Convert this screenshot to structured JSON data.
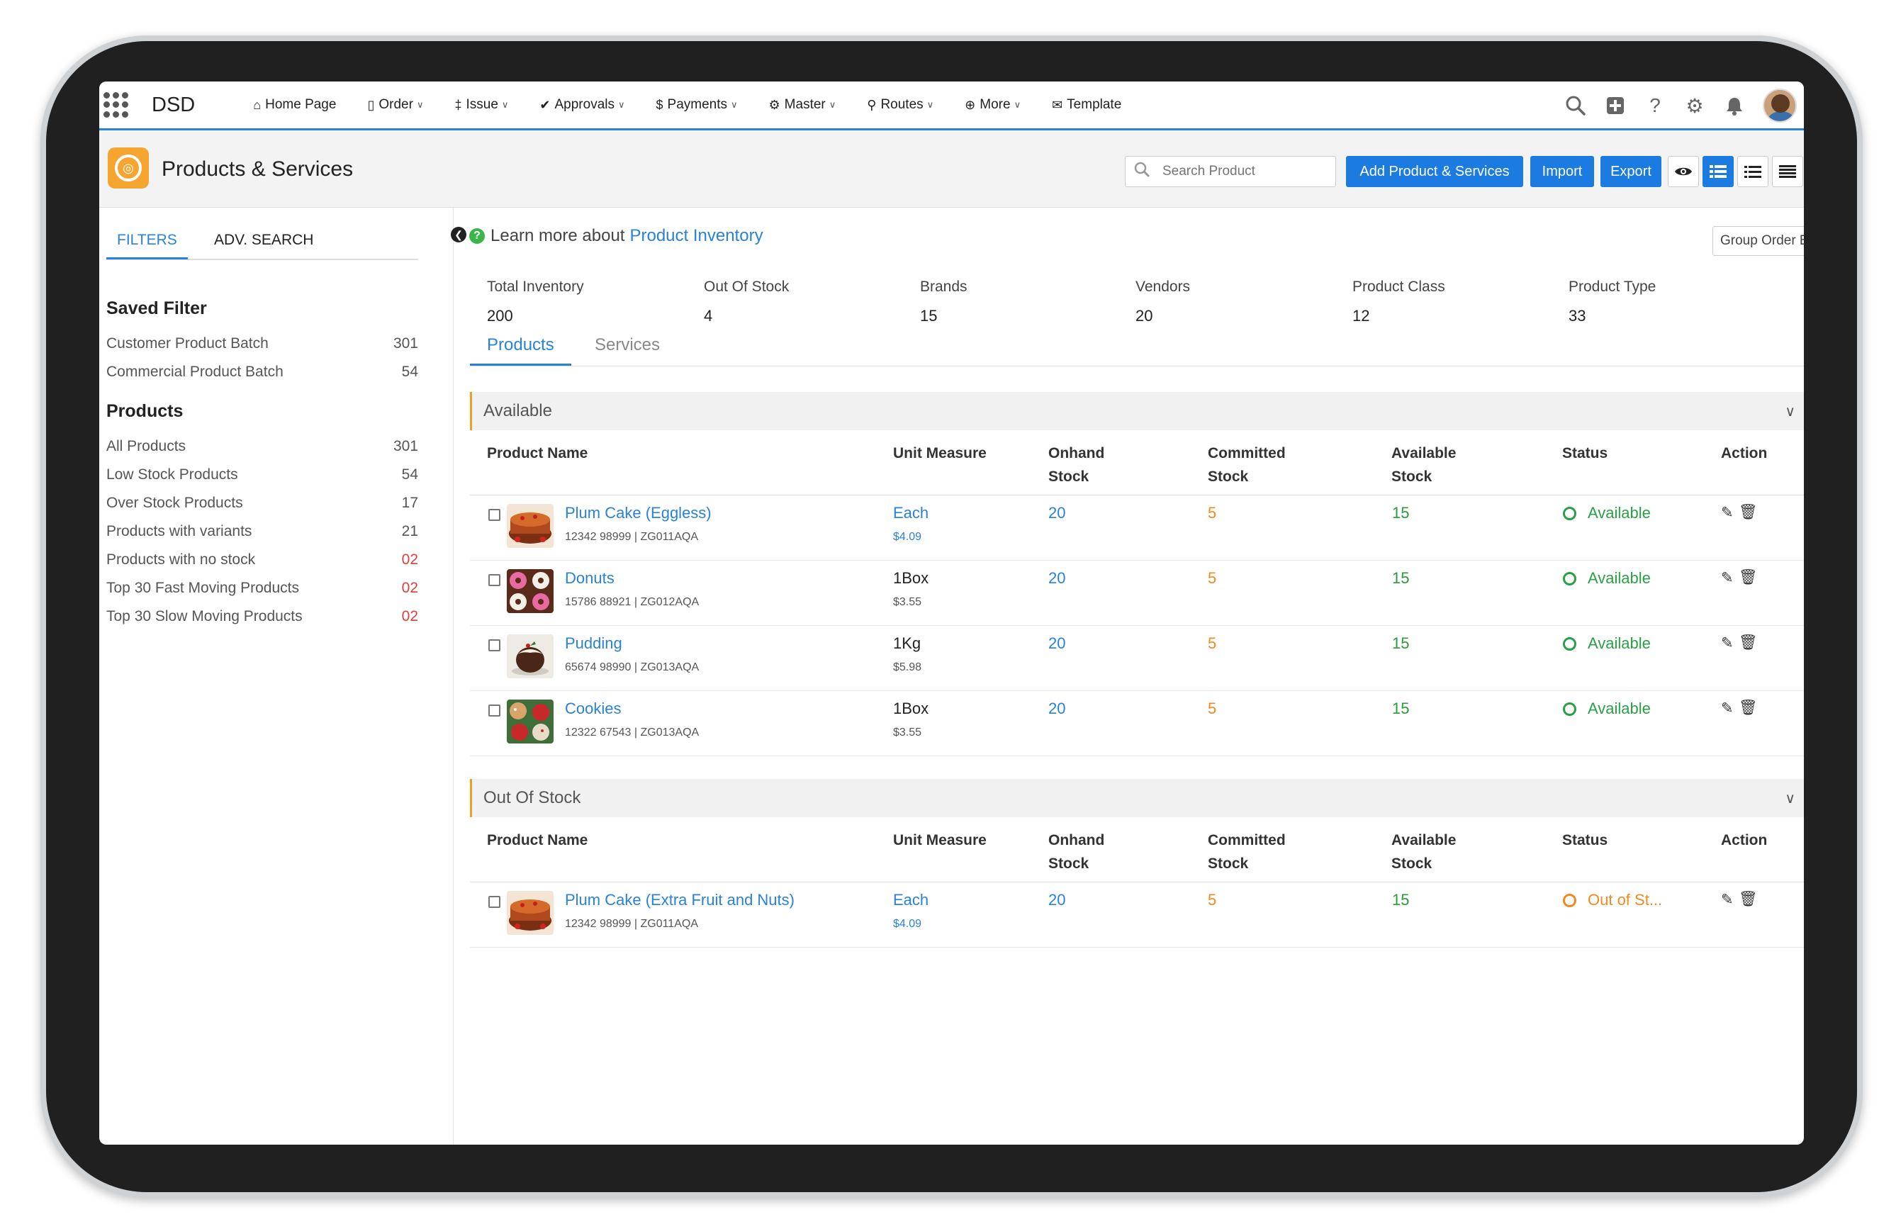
{
  "app": {
    "name": "DSD"
  },
  "nav": [
    {
      "icon": "home-icon",
      "glyph": "⌂",
      "label": "Home Page",
      "dropdown": false
    },
    {
      "icon": "document-icon",
      "glyph": "□",
      "label": "Order",
      "dropdown": true
    },
    {
      "icon": "issue-icon",
      "glyph": "‡",
      "label": "Issue",
      "dropdown": true
    },
    {
      "icon": "check-icon",
      "glyph": "✔",
      "label": "Approvals",
      "dropdown": true
    },
    {
      "icon": "dollar-icon",
      "glyph": "$",
      "label": "Payments",
      "dropdown": true
    },
    {
      "icon": "gear-icon",
      "glyph": "⚙",
      "label": "Master",
      "dropdown": true
    },
    {
      "icon": "map-pin-icon",
      "glyph": "▾",
      "label": "Routes",
      "dropdown": true
    },
    {
      "icon": "plus-circle-icon",
      "glyph": "⊕",
      "label": "More",
      "dropdown": true
    },
    {
      "icon": "envelope-icon",
      "glyph": "✉",
      "label": "Template",
      "dropdown": false
    }
  ],
  "page": {
    "title": "Products & Services"
  },
  "search": {
    "placeholder": "Search Product"
  },
  "buttons": {
    "add": "Add Product & Services",
    "import": "Import",
    "export": "Export"
  },
  "sidebar": {
    "tabs": [
      "FILTERS",
      "ADV. SEARCH"
    ],
    "saved_filter_heading": "Saved Filter",
    "saved_filters": [
      {
        "label": "Customer Product Batch",
        "count": "301",
        "red": false
      },
      {
        "label": "Commercial Product Batch",
        "count": "54",
        "red": false
      }
    ],
    "products_heading": "Products",
    "product_filters": [
      {
        "label": "All Products",
        "count": "301",
        "red": false
      },
      {
        "label": "Low Stock Products",
        "count": "54",
        "red": false
      },
      {
        "label": "Over Stock Products",
        "count": "17",
        "red": false
      },
      {
        "label": "Products with variants",
        "count": "21",
        "red": false
      },
      {
        "label": "Products with no stock",
        "count": "02",
        "red": true
      },
      {
        "label": "Top 30 Fast Moving Products",
        "count": "02",
        "red": true
      },
      {
        "label": "Top 30 Slow Moving Products",
        "count": "02",
        "red": true
      }
    ]
  },
  "learn": {
    "prefix": "Learn more about",
    "link": "Product Inventory"
  },
  "group_by": {
    "selected": "Group Order By"
  },
  "stats": [
    {
      "label": "Total Inventory",
      "value": "200"
    },
    {
      "label": "Out Of Stock",
      "value": "4"
    },
    {
      "label": "Brands",
      "value": "15"
    },
    {
      "label": "Vendors",
      "value": "20"
    },
    {
      "label": "Product Class",
      "value": "12"
    },
    {
      "label": "Product Type",
      "value": "33"
    }
  ],
  "product_tabs": [
    "Products",
    "Services"
  ],
  "columns": {
    "name": "Product Name",
    "uom": "Unit Measure",
    "onhand1": "Onhand",
    "onhand2": "Stock",
    "committed1": "Committed",
    "committed2": "Stock",
    "available1": "Available",
    "available2": "Stock",
    "status": "Status",
    "action": "Action"
  },
  "groups": {
    "available": {
      "title": "Available",
      "rows": [
        {
          "name": "Plum Cake (Eggless)",
          "sku": "12342 98999 | ZG011AQA",
          "uom": "Each",
          "price": "$4.09",
          "uom_blue": true,
          "onhand": "20",
          "committed": "5",
          "available": "15",
          "status": "Available"
        },
        {
          "name": "Donuts",
          "sku": "15786 88921 | ZG012AQA",
          "uom": "1Box",
          "price": "$3.55",
          "uom_blue": false,
          "onhand": "20",
          "committed": "5",
          "available": "15",
          "status": "Available"
        },
        {
          "name": "Pudding",
          "sku": "65674 98990 | ZG013AQA",
          "uom": "1Kg",
          "price": "$5.98",
          "uom_blue": false,
          "onhand": "20",
          "committed": "5",
          "available": "15",
          "status": "Available"
        },
        {
          "name": "Cookies",
          "sku": "12322 67543 | ZG013AQA",
          "uom": "1Box",
          "price": "$3.55",
          "uom_blue": false,
          "onhand": "20",
          "committed": "5",
          "available": "15",
          "status": "Available"
        }
      ]
    },
    "out_of_stock": {
      "title": "Out Of Stock",
      "rows": [
        {
          "name": "Plum Cake (Extra Fruit and Nuts)",
          "sku": "12342 98999 | ZG011AQA",
          "uom": "Each",
          "price": "$4.09",
          "uom_blue": true,
          "onhand": "20",
          "committed": "5",
          "available": "15",
          "status": "Out of St..."
        }
      ]
    }
  },
  "colors": {
    "accent": "#1b7be0",
    "link": "#2a82d6",
    "committed": "#f08a20",
    "available": "#2a9a3a",
    "alert": "#e0403a",
    "group_border": "#f0a020"
  }
}
